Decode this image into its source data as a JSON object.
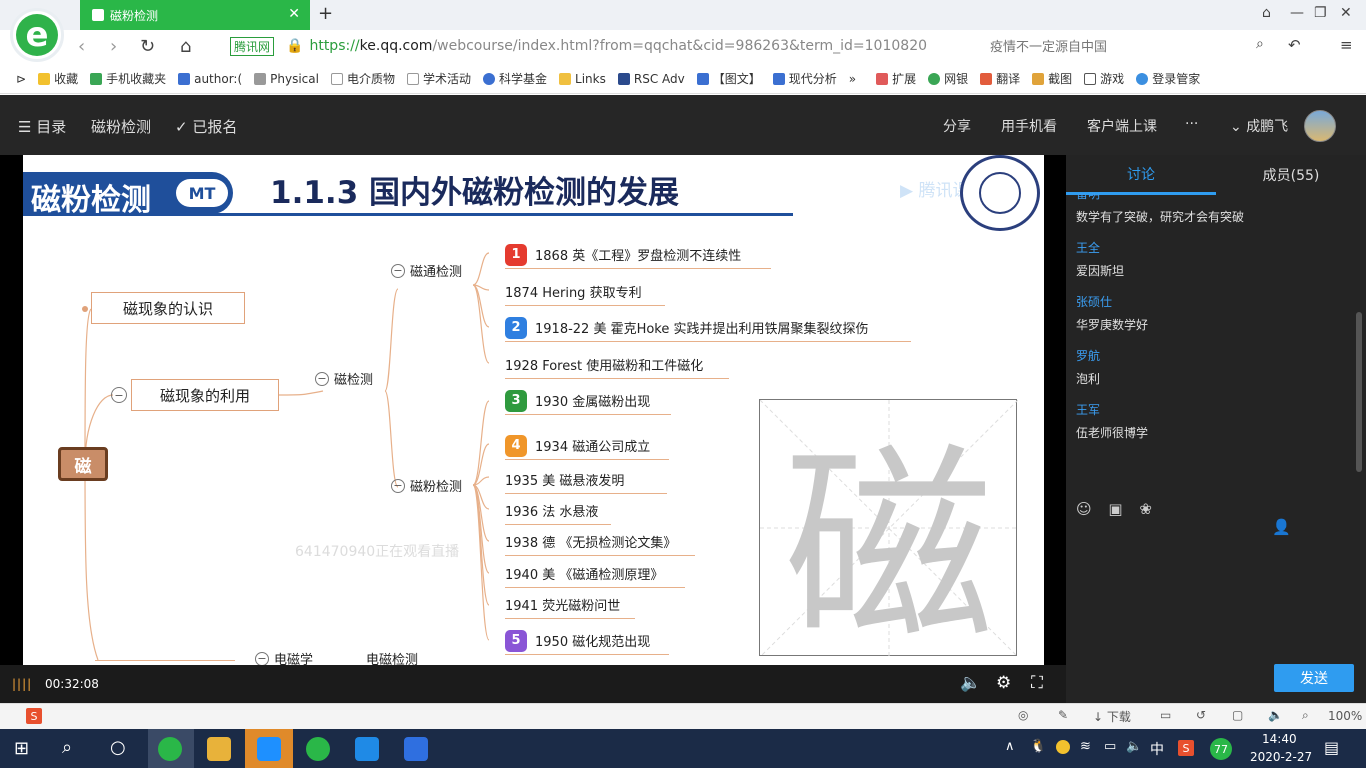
{
  "browser": {
    "tab_title": "磁粉检测",
    "url_cert": "腾讯网",
    "url_scheme": "https://",
    "url_host": "ke.qq.com",
    "url_path": "/webcourse/index.html?from=qqchat&cid=986263&term_id=1010820",
    "search_placeholder": "疫情不一定源自中国",
    "bookmarks": [
      "收藏",
      "手机收藏夹",
      "author:(",
      "Physical",
      "电介质物",
      "学术活动",
      "科学基金",
      "Links",
      "RSC Adv",
      "【图文】",
      "现代分析",
      "扩展",
      "网银",
      "翻译",
      "截图",
      "游戏",
      "登录管家"
    ]
  },
  "header": {
    "menu": "目录",
    "course": "磁粉检测",
    "enrolled": "已报名",
    "share": "分享",
    "phone": "用手机看",
    "client": "客户端上课",
    "more": "···",
    "user": "成鹏飞"
  },
  "slide": {
    "banner": "磁粉检测",
    "badge": "MT",
    "title": "1.1.3 国内外磁粉检测的发展",
    "watermark": "腾讯课堂",
    "root": "磁",
    "n1": "磁现象的认识",
    "n2": "磁现象的利用",
    "b_cijiance": "磁检测",
    "b_citong": "磁通检测",
    "b_cifen": "磁粉检测",
    "b_dianci": "电磁学",
    "b_diancijiance": "电磁检测",
    "leaves": [
      {
        "num": "1",
        "text": "1868 英《工程》罗盘检测不连续性"
      },
      {
        "num": "",
        "text": "1874 Hering 获取专利"
      },
      {
        "num": "2",
        "text": "1918-22 美 霍克Hoke 实践并提出利用铁屑聚集裂纹探伤"
      },
      {
        "num": "",
        "text": "1928 Forest 使用磁粉和工件磁化"
      },
      {
        "num": "3",
        "text": "1930 金属磁粉出现"
      },
      {
        "num": "4",
        "text": "1934 磁通公司成立"
      },
      {
        "num": "",
        "text": "1935 美 磁悬液发明"
      },
      {
        "num": "",
        "text": "1936 法 水悬液"
      },
      {
        "num": "",
        "text": "1938 德 《无损检测论文集》"
      },
      {
        "num": "",
        "text": "1940 美 《磁通检测原理》"
      },
      {
        "num": "",
        "text": "1941 荧光磁粉问世"
      },
      {
        "num": "5",
        "text": "1950 磁化规范出现"
      }
    ],
    "big_char": "磁",
    "viewer_notice": "641470940正在观看直播"
  },
  "player": {
    "time": "00:32:08"
  },
  "sidebar": {
    "tab_discuss": "讨论",
    "tab_members": "成员(55)",
    "messages": [
      {
        "user": "雷明",
        "text": "数学有了突破，研究才会有突破"
      },
      {
        "user": "王全",
        "text": "爱因斯坦"
      },
      {
        "user": "张硕仕",
        "text": "华罗庚数学好"
      },
      {
        "user": "罗航",
        "text": "泡利"
      },
      {
        "user": "王军",
        "text": "伍老师很博学"
      }
    ],
    "send": "发送"
  },
  "statusbar": {
    "download": "下载",
    "zoom": "100%"
  },
  "taskbar": {
    "time": "14:40",
    "date": "2020-2-27",
    "ime": "中",
    "badge": "77"
  },
  "colors": {
    "accent_green": "#2ab748",
    "slide_blue": "#1f4f9b",
    "sidebar_blue": "#2f9cf0"
  }
}
